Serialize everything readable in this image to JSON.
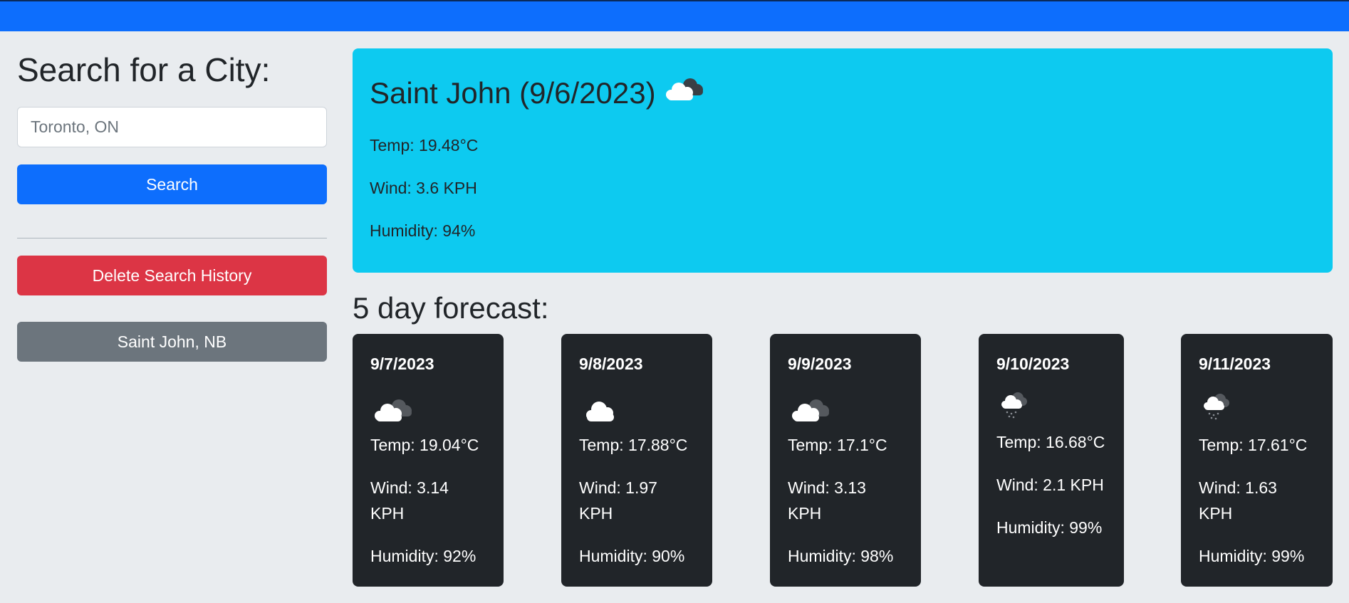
{
  "sidebar": {
    "title": "Search for a City:",
    "search_placeholder": "Toronto, ON",
    "search_value": "",
    "search_button": "Search",
    "delete_button": "Delete Search History",
    "history": [
      {
        "label": "Saint John, NB"
      }
    ]
  },
  "current": {
    "title": "Saint John (9/6/2023)",
    "icon": "cloudy-icon",
    "temp": "Temp: 19.48°C",
    "wind": "Wind: 3.6 KPH",
    "humidity": "Humidity: 94%"
  },
  "forecast": {
    "title": "5 day forecast:",
    "days": [
      {
        "date": "9/7/2023",
        "icon": "cloudy-icon",
        "temp": "Temp: 19.04°C",
        "wind": "Wind: 3.14 KPH",
        "humidity": "Humidity: 92%"
      },
      {
        "date": "9/8/2023",
        "icon": "cloud-icon",
        "temp": "Temp: 17.88°C",
        "wind": "Wind: 1.97 KPH",
        "humidity": "Humidity: 90%"
      },
      {
        "date": "9/9/2023",
        "icon": "cloudy-icon",
        "temp": "Temp: 17.1°C",
        "wind": "Wind: 3.13 KPH",
        "humidity": "Humidity: 98%"
      },
      {
        "date": "9/10/2023",
        "icon": "rain-icon",
        "temp": "Temp: 16.68°C",
        "wind": "Wind: 2.1 KPH",
        "humidity": "Humidity: 99%"
      },
      {
        "date": "9/11/2023",
        "icon": "rain-icon",
        "temp": "Temp: 17.61°C",
        "wind": "Wind: 1.63 KPH",
        "humidity": "Humidity: 99%"
      }
    ]
  },
  "colors": {
    "topbar": "#0d6efd",
    "background": "#e9ecef",
    "current_bg": "#0dcaf0",
    "card_bg": "#212529",
    "primary": "#0d6efd",
    "danger": "#dc3545",
    "secondary": "#6c757d"
  }
}
